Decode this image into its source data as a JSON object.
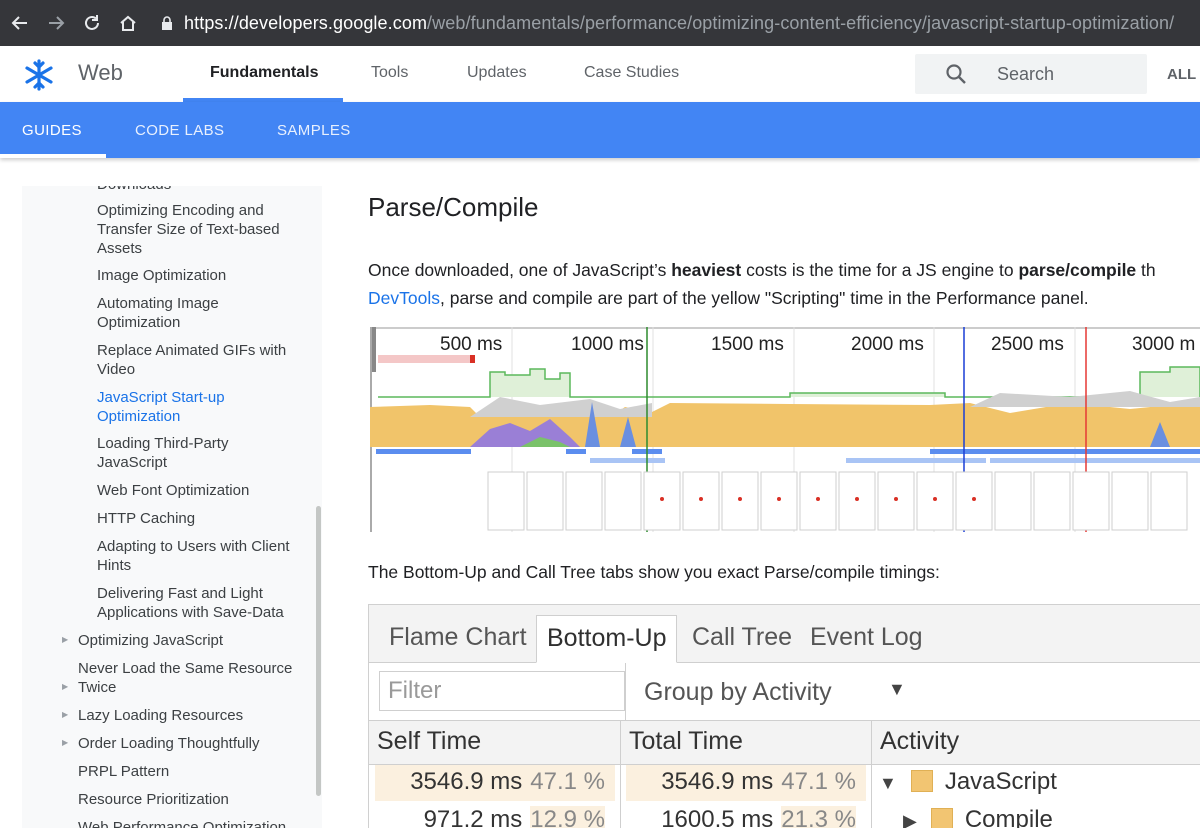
{
  "browser": {
    "url_host": "https://developers.google.com",
    "url_path": "/web/fundamentals/performance/optimizing-content-efficiency/javascript-startup-optimization/"
  },
  "header": {
    "brand": "Web",
    "tabs": [
      "Fundamentals",
      "Tools",
      "Updates",
      "Case Studies"
    ],
    "search_placeholder": "Search",
    "all_label": "ALL"
  },
  "subnav": {
    "tabs": [
      "GUIDES",
      "CODE LABS",
      "SAMPLES"
    ]
  },
  "sidebar": {
    "cut_top": "Downloads",
    "items": [
      "Optimizing Encoding and Transfer Size of Text-based Assets",
      "Image Optimization",
      "Automating Image Optimization",
      "Replace Animated GIFs with Video",
      "JavaScript Start-up Optimization",
      "Loading Third-Party JavaScript",
      "Web Font Optimization",
      "HTTP Caching",
      "Adapting to Users with Client Hints",
      "Delivering Fast and Light Applications with Save-Data"
    ],
    "items_l1": [
      "Optimizing JavaScript",
      "Never Load the Same Resource Twice",
      "Lazy Loading Resources",
      "Order Loading Thoughtfully",
      "PRPL Pattern",
      "Resource Prioritization",
      "Web Performance Optimization"
    ]
  },
  "main": {
    "title": "Parse/Compile",
    "para_pre": "Once downloaded, one of JavaScript’s ",
    "para_bold1": "heaviest",
    "para_mid": " costs is the time for a JS engine to ",
    "para_bold2": "parse/compile",
    "para_tail": " th",
    "para_link": "DevTools",
    "para_line2": ", parse and compile are part of the yellow \"Scripting\" time in the Performance panel.",
    "para2": "The Bottom-Up and Call Tree tabs show you exact Parse/compile timings:",
    "timeline_ticks": [
      "500 ms",
      "1000 ms",
      "1500 ms",
      "2000 ms",
      "2500 ms",
      "3000 m"
    ]
  },
  "devtools": {
    "tabs": [
      "Flame Chart",
      "Bottom-Up",
      "Call Tree",
      "Event Log"
    ],
    "filter_placeholder": "Filter",
    "group_by": "Group by Activity",
    "columns": [
      "Self Time",
      "Total Time",
      "Activity"
    ],
    "rows": [
      {
        "self": "3546.9 ms",
        "self_pct": "47.1 %",
        "total": "3546.9 ms",
        "total_pct": "47.1 %",
        "activity": "JavaScript"
      },
      {
        "self": "971.2 ms",
        "self_pct": "12.9 %",
        "total": "1600.5 ms",
        "total_pct": "21.3 %",
        "activity": "Compile"
      }
    ]
  }
}
